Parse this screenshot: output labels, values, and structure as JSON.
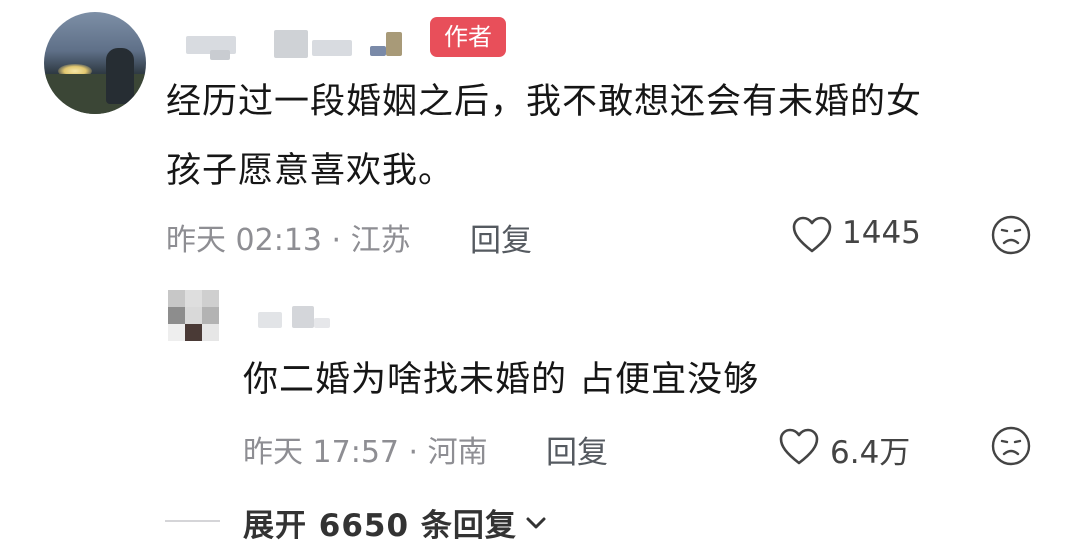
{
  "comment": {
    "author_badge": "作者",
    "text": "经历过一段婚姻之后，我不敢想还会有未婚的女孩子愿意喜欢我。",
    "text_line1": "经历过一段婚姻之后，我不敢想还会有未婚的女",
    "text_line2": "孩子愿意喜欢我。",
    "meta": "昨天 02:13 · 江苏",
    "reply_label": "回复",
    "like_count": "1445",
    "icons": {
      "like": "heart-outline-icon",
      "dislike": "sad-face-icon"
    }
  },
  "reply": {
    "text": "你二婚为啥找未婚的 占便宜没够",
    "meta": "昨天 17:57 · 河南",
    "reply_label": "回复",
    "like_count": "6.4万",
    "icons": {
      "like": "heart-outline-icon",
      "dislike": "sad-face-icon"
    }
  },
  "expand": {
    "label": "展开 6650 条回复",
    "icon": "chevron-down-icon"
  },
  "colors": {
    "badge": "#e84f5a",
    "meta": "#8e8e93"
  }
}
